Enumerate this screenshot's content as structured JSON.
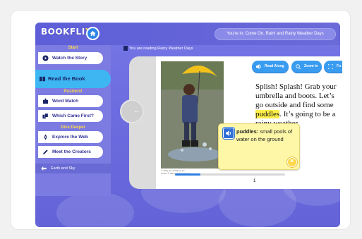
{
  "app": {
    "logo_text": "BOOKFLIX",
    "location": "You're in: Come On, Rain! and Rainy Weather Days"
  },
  "sidebar": {
    "start_heading": "Start",
    "watch_story": "Watch the Story",
    "read_book": "Read the Book",
    "puzzlers_heading": "Puzzlers!",
    "word_match": "Word Match",
    "which_first": "Which Came First?",
    "dive_heading": "Dive Deeper",
    "explore_web": "Explore the Web",
    "meet_creators": "Meet the Creators",
    "earth_sky": "Earth and Sky"
  },
  "reader": {
    "reading_label": "You are reading Rainy Weather Days",
    "read_along": "Read Along",
    "zoom_in": "Zoom In",
    "full_label": "Fu",
    "text_before": "Splish! Splash! Grab your umbrella and boots. Let’s go outside and find some ",
    "highlight_word": "puddles",
    "text_after": ". It’s going to be a rainy weather",
    "credit_line1": "© Jeffry Jo Lin/Alamy, Inc.",
    "credit_line2": "Cover: © Nemo/ Alamy Images",
    "page_number": "1",
    "progress_fraction": 0.23
  },
  "glossary": {
    "word": "puddles:",
    "definition": " small pools of water on the ground"
  },
  "colors": {
    "accent_blue": "#3db6f2",
    "background_purple": "#6d6de0",
    "highlight_yellow": "#fff04a"
  }
}
